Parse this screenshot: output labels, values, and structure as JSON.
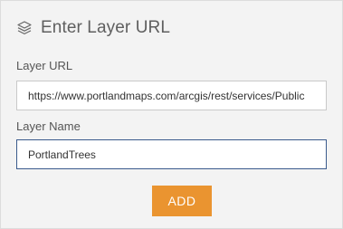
{
  "header": {
    "icon": "layers-icon",
    "title": "Enter Layer URL"
  },
  "url": {
    "label": "Layer URL",
    "value": "https://www.portlandmaps.com/arcgis/rest/services/Public"
  },
  "name": {
    "label": "Layer Name",
    "value": "PortlandTrees"
  },
  "actions": {
    "add_label": "ADD"
  },
  "colors": {
    "accent": "#ea9430",
    "panel_bg": "#f3f3f3",
    "focus_border": "#3a5a8c"
  }
}
